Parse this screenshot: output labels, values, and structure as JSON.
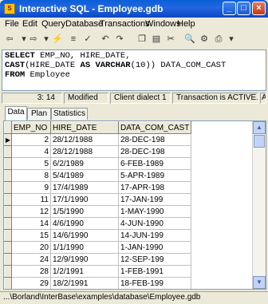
{
  "window": {
    "title": "Interactive SQL - Employee.gdb"
  },
  "menu": [
    "File",
    "Edit",
    "Query",
    "Database",
    "Transactions",
    "Windows",
    "Help"
  ],
  "sql": {
    "line1_kw1": "SELECT",
    "line1_rest": " EMP_NO, HIRE_DATE,",
    "line2_kw1": "CAST",
    "line2_mid": "(HIRE_DATE ",
    "line2_kw2": "AS",
    "line2_sp": " ",
    "line2_kw3": "VARCHAR",
    "line2_rest": "(10)) DATA_COM_CAST",
    "line3_kw1": "FROM",
    "line3_rest": " Employee"
  },
  "status": {
    "position": "3: 14",
    "modified": "Modified",
    "dialect": "Client dialect 1",
    "transaction": "Transaction is ACTIVE.",
    "extra": "A"
  },
  "tabs": [
    "Data",
    "Plan",
    "Statistics"
  ],
  "grid": {
    "columns": [
      "EMP_NO",
      "HIRE_DATE",
      "DATA_COM_CAST"
    ],
    "rows": [
      [
        "2",
        "28/12/1988",
        "28-DEC-198"
      ],
      [
        "4",
        "28/12/1988",
        "28-DEC-198"
      ],
      [
        "5",
        "6/2/1989",
        "6-FEB-1989"
      ],
      [
        "8",
        "5/4/1989",
        "5-APR-1989"
      ],
      [
        "9",
        "17/4/1989",
        "17-APR-198"
      ],
      [
        "11",
        "17/1/1990",
        "17-JAN-199"
      ],
      [
        "12",
        "1/5/1990",
        "1-MAY-1990"
      ],
      [
        "14",
        "4/6/1990",
        "4-JUN-1990"
      ],
      [
        "15",
        "14/6/1990",
        "14-JUN-199"
      ],
      [
        "20",
        "1/1/1990",
        "1-JAN-1990"
      ],
      [
        "24",
        "12/9/1990",
        "12-SEP-199"
      ],
      [
        "28",
        "1/2/1991",
        "1-FEB-1991"
      ],
      [
        "29",
        "18/2/1991",
        "18-FEB-199"
      ],
      [
        "34",
        "21/3/1991",
        "21-MAR-199"
      ]
    ]
  },
  "footer": {
    "path": "...\\Borland\\InterBase\\examples\\database\\Employee.gdb"
  }
}
